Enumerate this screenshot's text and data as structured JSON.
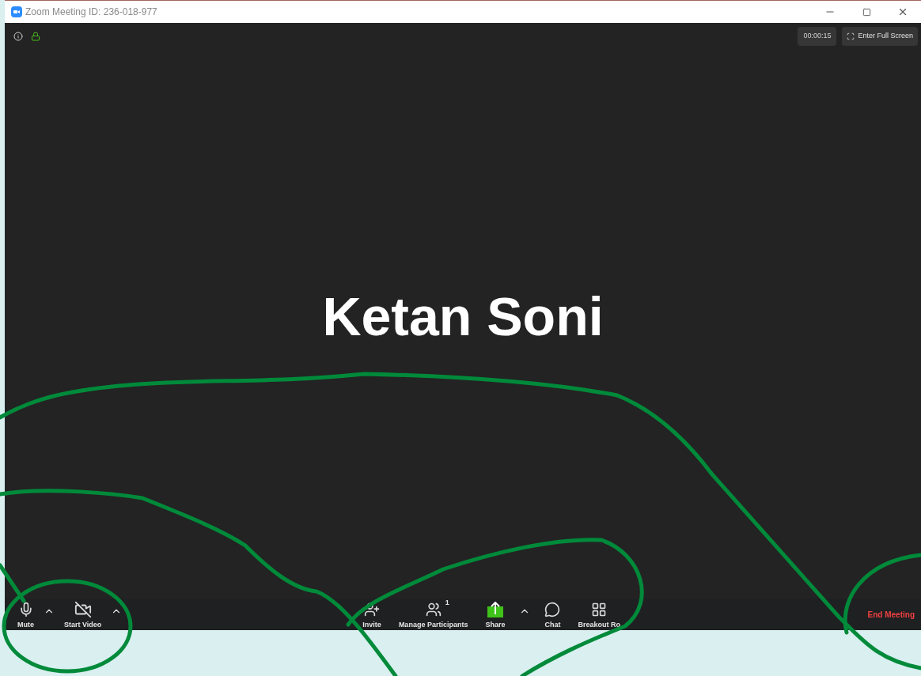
{
  "window": {
    "title": "Zoom Meeting ID: 236-018-977"
  },
  "meeting_info": {
    "timer": "00:00:15",
    "full_screen_button": "Enter Full Screen"
  },
  "speaker": {
    "name": "Ketan Soni"
  },
  "toolbar": {
    "left": [
      {
        "kind": "mute",
        "label": "Mute",
        "menu": true
      },
      {
        "kind": "video",
        "label": "Start Video",
        "menu": true
      }
    ],
    "center": [
      {
        "kind": "invite",
        "label": "Invite",
        "menu": false
      },
      {
        "kind": "participants",
        "label": "Manage Participants",
        "count": "1",
        "menu": false
      },
      {
        "kind": "share",
        "label": "Share",
        "menu": true
      },
      {
        "kind": "chat",
        "label": "Chat",
        "menu": false
      },
      {
        "kind": "breakout",
        "label": "Breakout Ro",
        "menu": false
      }
    ],
    "end_button": "End Meeting"
  }
}
